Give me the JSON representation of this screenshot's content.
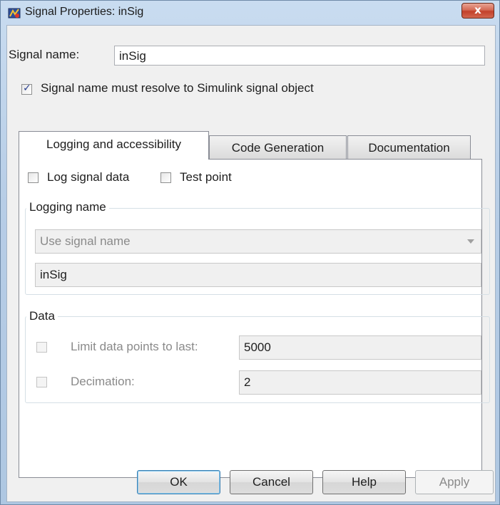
{
  "window": {
    "title": "Signal Properties: inSig",
    "close_label": "x"
  },
  "signal_name": {
    "label": "Signal name:",
    "value": "inSig"
  },
  "resolve_checkbox": {
    "label": "Signal name must resolve to Simulink signal object",
    "checked": true
  },
  "tabs": [
    {
      "label": "Logging and accessibility",
      "active": true
    },
    {
      "label": "Code Generation",
      "active": false
    },
    {
      "label": "Documentation",
      "active": false
    }
  ],
  "logging": {
    "log_signal_data_label": "Log signal data",
    "test_point_label": "Test point",
    "group_title": "Logging name",
    "name_mode": "Use signal name",
    "name_value": "inSig"
  },
  "data_group": {
    "title": "Data",
    "limit_label": "Limit data points to last:",
    "limit_value": "5000",
    "decimation_label": "Decimation:",
    "decimation_value": "2"
  },
  "buttons": {
    "ok": "OK",
    "cancel": "Cancel",
    "help": "Help",
    "apply": "Apply"
  },
  "icons": {
    "app": "simulink-signal-icon",
    "close": "close-icon",
    "dropdown": "chevron-down-icon"
  },
  "colors": {
    "frame": "#b7cde6",
    "close_button": "#c2402a",
    "client": "#f0f0f0",
    "panel": "#ffffff"
  }
}
